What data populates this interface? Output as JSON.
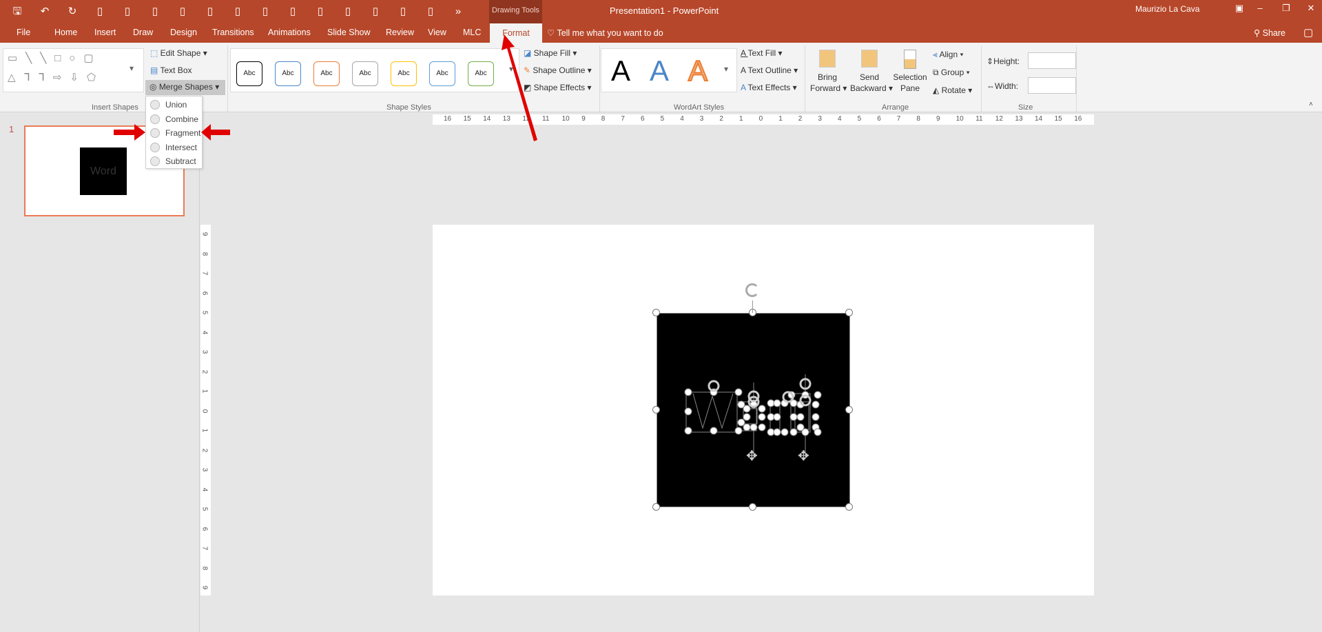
{
  "title_bar": {
    "context_label": "Drawing Tools",
    "title": "Presentation1  -  PowerPoint",
    "user": "Maurizio La Cava",
    "share": "Share",
    "qat_icons": [
      "save-icon",
      "undo-icon",
      "redo-icon",
      "present-icon",
      "bring-forward-icon",
      "send-backward-icon",
      "align-left-icon",
      "align-right-icon",
      "align-top-icon",
      "align-middle-icon",
      "align-center-icon",
      "align-bottom-icon",
      "bring-front-icon",
      "send-back-icon",
      "fit-icon",
      "slide-end-icon",
      "more-icon"
    ]
  },
  "tabs": [
    "File",
    "Home",
    "Insert",
    "Draw",
    "Design",
    "Transitions",
    "Animations",
    "Slide Show",
    "Review",
    "View",
    "MLC"
  ],
  "active_tab": "Format",
  "tell_me": "Tell me what you want to do",
  "ribbon": {
    "insert_shapes": {
      "label": "Insert Shapes",
      "edit_shape": "Edit Shape",
      "text_box": "Text Box",
      "merge_shapes": "Merge Shapes"
    },
    "shape_styles": {
      "label": "Shape Styles",
      "swatches": [
        {
          "text": "Abc",
          "color": "#000000"
        },
        {
          "text": "Abc",
          "color": "#4a86c8"
        },
        {
          "text": "Abc",
          "color": "#ed7d31"
        },
        {
          "text": "Abc",
          "color": "#a5a5a5"
        },
        {
          "text": "Abc",
          "color": "#ffc000"
        },
        {
          "text": "Abc",
          "color": "#5b9bd5"
        },
        {
          "text": "Abc",
          "color": "#70ad47"
        }
      ],
      "shape_fill": "Shape Fill",
      "shape_outline": "Shape Outline",
      "shape_effects": "Shape Effects"
    },
    "wordart": {
      "label": "WordArt Styles",
      "samples": [
        "A",
        "A",
        "A"
      ],
      "text_fill": "Text Fill",
      "text_outline": "Text Outline",
      "text_effects": "Text Effects"
    },
    "arrange": {
      "label": "Arrange",
      "bring_forward_1": "Bring",
      "bring_forward_2": "Forward",
      "send_backward_1": "Send",
      "send_backward_2": "Backward",
      "selection_pane_1": "Selection",
      "selection_pane_2": "Pane",
      "align": "Align",
      "group": "Group",
      "rotate": "Rotate"
    },
    "size": {
      "label": "Size",
      "height": "Height:",
      "width": "Width:",
      "height_value": "",
      "width_value": ""
    }
  },
  "merge_menu": [
    "Union",
    "Combine",
    "Fragment",
    "Intersect",
    "Subtract"
  ],
  "slide_number": "1",
  "thumb_text": "Word",
  "hruler": [
    "16",
    "15",
    "14",
    "13",
    "12",
    "11",
    "10",
    "9",
    "8",
    "7",
    "6",
    "5",
    "4",
    "3",
    "2",
    "1",
    "0",
    "1",
    "2",
    "3",
    "4",
    "5",
    "6",
    "7",
    "8",
    "9",
    "10",
    "11",
    "12",
    "13",
    "14",
    "15",
    "16"
  ],
  "vruler": [
    "9",
    "8",
    "7",
    "6",
    "5",
    "4",
    "3",
    "2",
    "1",
    "0",
    "1",
    "2",
    "3",
    "4",
    "5",
    "6",
    "7",
    "8",
    "9"
  ],
  "colors": {
    "accent": "#b7472a",
    "annotation_arrow": "#e00000"
  }
}
